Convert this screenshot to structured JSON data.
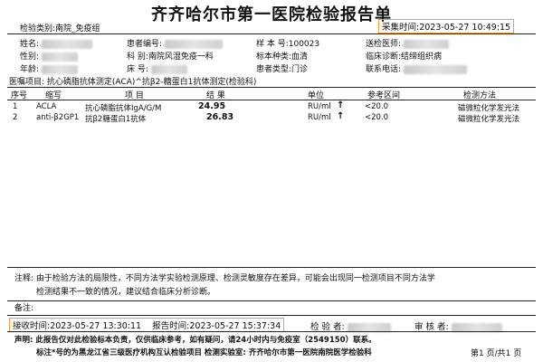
{
  "report": {
    "title": "齐齐哈尔市第一医院检验报告单",
    "category": "检验类别:南院_免疫组",
    "collect_time": "采集时间:2023-05-27 10:49:15"
  },
  "patient": {
    "name_label": "姓名:",
    "sex_label": "性别:",
    "age_label": "年龄:",
    "patient_no_label": "患者编号:",
    "dept_label": "科    别:南院风湿免疫一科",
    "bed_label": "床    号:",
    "sample_no": "样 本 号:100023",
    "sample_type": "标本种类:血清",
    "patient_type": "患者类型:门诊",
    "send_doctor_label": "送检医师:",
    "diagnosis": "临床诊断:结缔组织病",
    "phone_label": "联系电话:",
    "items_label": "医嘱项目: 抗心磷脂抗体测定(ACA)^抗β2-糖蛋白1抗体测定(检验科)"
  },
  "table": {
    "headers": {
      "seq": "序号",
      "code": "缩写",
      "item": "项    目",
      "result": "结  果",
      "unit": "单位",
      "ref": "参考区间",
      "method": "检测方法"
    },
    "rows": [
      {
        "seq": "1",
        "code": "ACLA",
        "item": "抗心磷脂抗体IgA/G/M",
        "result": "24.95",
        "unit": "RU/ml",
        "flag": "↑",
        "ref": "<20.0",
        "method": "磁微粒化学发光法"
      },
      {
        "seq": "2",
        "code": "anti-β2GP1",
        "item": "抗β2糖蛋白1抗体",
        "result": "26.83",
        "unit": "RU/ml",
        "flag": "↑",
        "ref": "<20.0",
        "method": "磁微粒化学发光法"
      }
    ]
  },
  "notes": {
    "note1": "注释:  由于检验方法的局限性，不同方法学实验检测原理、检测灵敏度存在差异，可能会出现同一检测项目不同方法学",
    "note2": "检测结果不一致的情况，建议结合临床分析诊断。",
    "remark": "备注:"
  },
  "footer": {
    "receive_time": "接收时间:2023-05-27 13:30:11",
    "report_time": "报告时间:2023-05-27 15:37:34",
    "tester_label": "检  验  者:",
    "reviewer_label": "审 核 者:",
    "statement": "声明: 此报告仅对此检验标本负责，仅供临床参考，如有疑问，请24小时内与免疫室（2549150）联系。",
    "mark_note": "标注*号的为黑龙江省三级医疗机构互认检验项目  检测实验室: 齐齐哈尔市第一医院南院医学检验科",
    "page": "第1 页/共1 页"
  }
}
